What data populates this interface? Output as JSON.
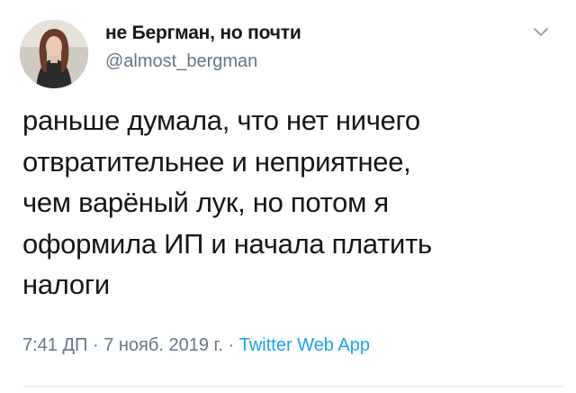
{
  "author": {
    "display_name": "не Бергман, но почти",
    "handle": "@almost_bergman"
  },
  "tweet": {
    "text": "раньше думала, что нет ничего\nотвратительнее и неприятнее,\nчем варёный лук, но потом я\nоформила ИП и начала платить\nналоги"
  },
  "meta": {
    "time": "7:41 ДП",
    "separator": "·",
    "date": "7 нояб. 2019 г.",
    "source": "Twitter Web App"
  },
  "icons": {
    "menu": "chevron-down-icon",
    "avatar": "avatar"
  },
  "colors": {
    "text": "#14171a",
    "muted": "#657786",
    "link": "#1da1f2",
    "divider": "#e1e8ed"
  }
}
